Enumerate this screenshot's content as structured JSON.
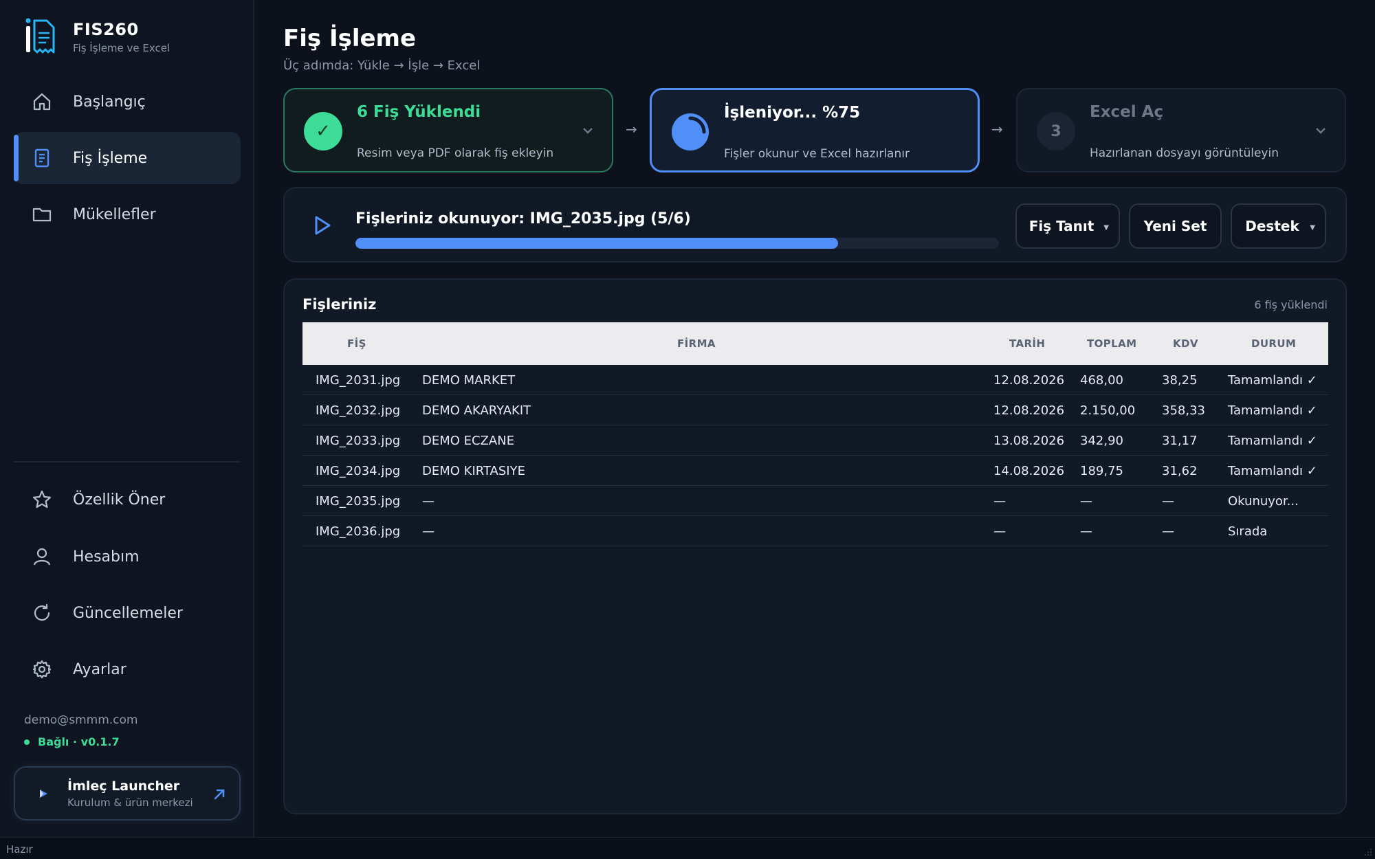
{
  "app": {
    "name": "FIS260",
    "subtitle": "Fiş İşleme ve Excel"
  },
  "sidebar": {
    "nav": [
      {
        "label": "Başlangıç",
        "icon": "home-icon"
      },
      {
        "label": "Fiş İşleme",
        "icon": "document-icon",
        "active": true
      },
      {
        "label": "Mükellefler",
        "icon": "folder-icon"
      }
    ],
    "bottom_nav": [
      {
        "label": "Özellik Öner",
        "icon": "star-icon"
      },
      {
        "label": "Hesabım",
        "icon": "user-icon"
      },
      {
        "label": "Güncellemeler",
        "icon": "refresh-icon"
      },
      {
        "label": "Ayarlar",
        "icon": "gear-icon"
      }
    ],
    "user_email": "demo@smmm.com",
    "connection": "Bağlı · v0.1.7",
    "launcher": {
      "title": "İmleç Launcher",
      "subtitle": "Kurulum & ürün merkezi"
    }
  },
  "page": {
    "title": "Fiş İşleme",
    "subtitle": "Üç adımda: Yükle → İşle → Excel"
  },
  "steps": [
    {
      "title": "6 Fiş Yüklendi",
      "desc": "Resim veya PDF olarak fiş ekleyin",
      "state": "done",
      "mark": "✓"
    },
    {
      "title": "İşleniyor...  %75",
      "desc": "Fişler okunur ve Excel hazırlanır",
      "state": "active"
    },
    {
      "title": "Excel Aç",
      "desc": "Hazırlanan dosyayı görüntüleyin",
      "state": "pending",
      "number": "3"
    }
  ],
  "step_arrow": "→",
  "progress": {
    "text": "Fişleriniz okunuyor: IMG_2035.jpg (5/6)",
    "fraction": 0.75
  },
  "actions": {
    "identify": "Fiş Tanıt",
    "new_set": "Yeni Set",
    "support": "Destek"
  },
  "table": {
    "title": "Fişleriniz",
    "count": "6 fiş yüklendi",
    "headers": {
      "fis": "FİŞ",
      "firma": "FİRMA",
      "tarih": "TARİH",
      "toplam": "TOPLAM",
      "kdv": "KDV",
      "durum": "DURUM"
    },
    "rows": [
      {
        "fis": "IMG_2031.jpg",
        "firma": "DEMO MARKET",
        "tarih": "12.08.2026",
        "toplam": "468,00",
        "kdv": "38,25",
        "durum": "Tamamlandı ✓"
      },
      {
        "fis": "IMG_2032.jpg",
        "firma": "DEMO AKARYAKIT",
        "tarih": "12.08.2026",
        "toplam": "2.150,00",
        "kdv": "358,33",
        "durum": "Tamamlandı ✓"
      },
      {
        "fis": "IMG_2033.jpg",
        "firma": "DEMO ECZANE",
        "tarih": "13.08.2026",
        "toplam": "342,90",
        "kdv": "31,17",
        "durum": "Tamamlandı ✓"
      },
      {
        "fis": "IMG_2034.jpg",
        "firma": "DEMO KIRTASIYE",
        "tarih": "14.08.2026",
        "toplam": "189,75",
        "kdv": "31,62",
        "durum": "Tamamlandı ✓"
      },
      {
        "fis": "IMG_2035.jpg",
        "firma": "—",
        "tarih": "—",
        "toplam": "—",
        "kdv": "—",
        "durum": "Okunuyor..."
      },
      {
        "fis": "IMG_2036.jpg",
        "firma": "—",
        "tarih": "—",
        "toplam": "—",
        "kdv": "—",
        "durum": "Sırada"
      }
    ]
  },
  "statusbar": "Hazır",
  "colors": {
    "accent": "#4f8ff7",
    "success": "#3ddc97",
    "background": "#0c111b"
  }
}
